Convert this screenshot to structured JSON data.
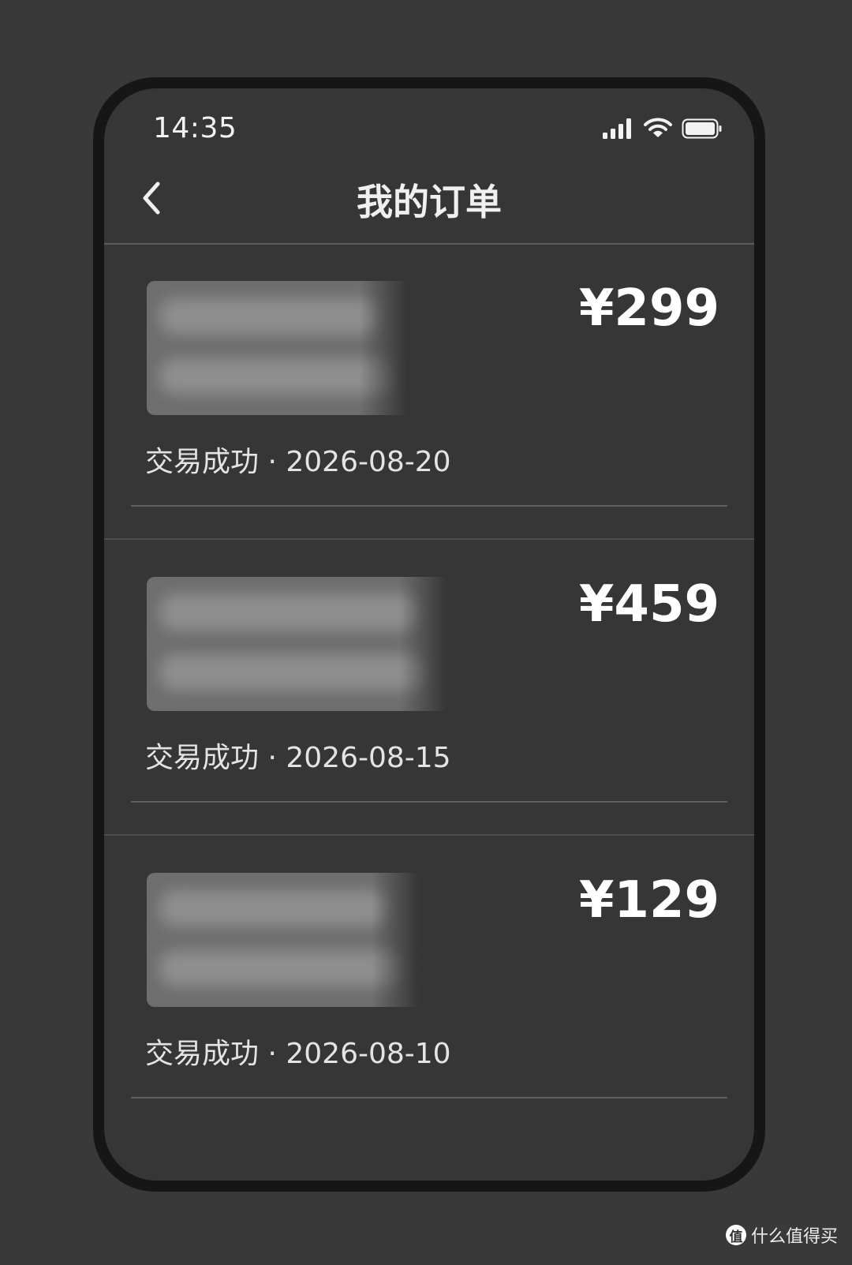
{
  "status_bar": {
    "time": "14:35",
    "icons": [
      "signal-icon",
      "wifi-icon",
      "battery-icon"
    ]
  },
  "nav": {
    "back_icon": "chevron-left-icon",
    "title": "我的订单"
  },
  "orders": [
    {
      "price": "¥299",
      "status": "交易成功",
      "separator": " · ",
      "date": "2026-08-20"
    },
    {
      "price": "¥459",
      "status": "交易成功",
      "separator": " · ",
      "date": "2026-08-15"
    },
    {
      "price": "¥129",
      "status": "交易成功",
      "separator": " · ",
      "date": "2026-08-10"
    }
  ],
  "watermark": {
    "logo": "值",
    "text": "什么值得买"
  },
  "colors": {
    "background": "#393939",
    "frame": "#161616",
    "screen": "#363636",
    "text_primary": "#ffffff",
    "text_secondary": "#e4e4e4"
  }
}
